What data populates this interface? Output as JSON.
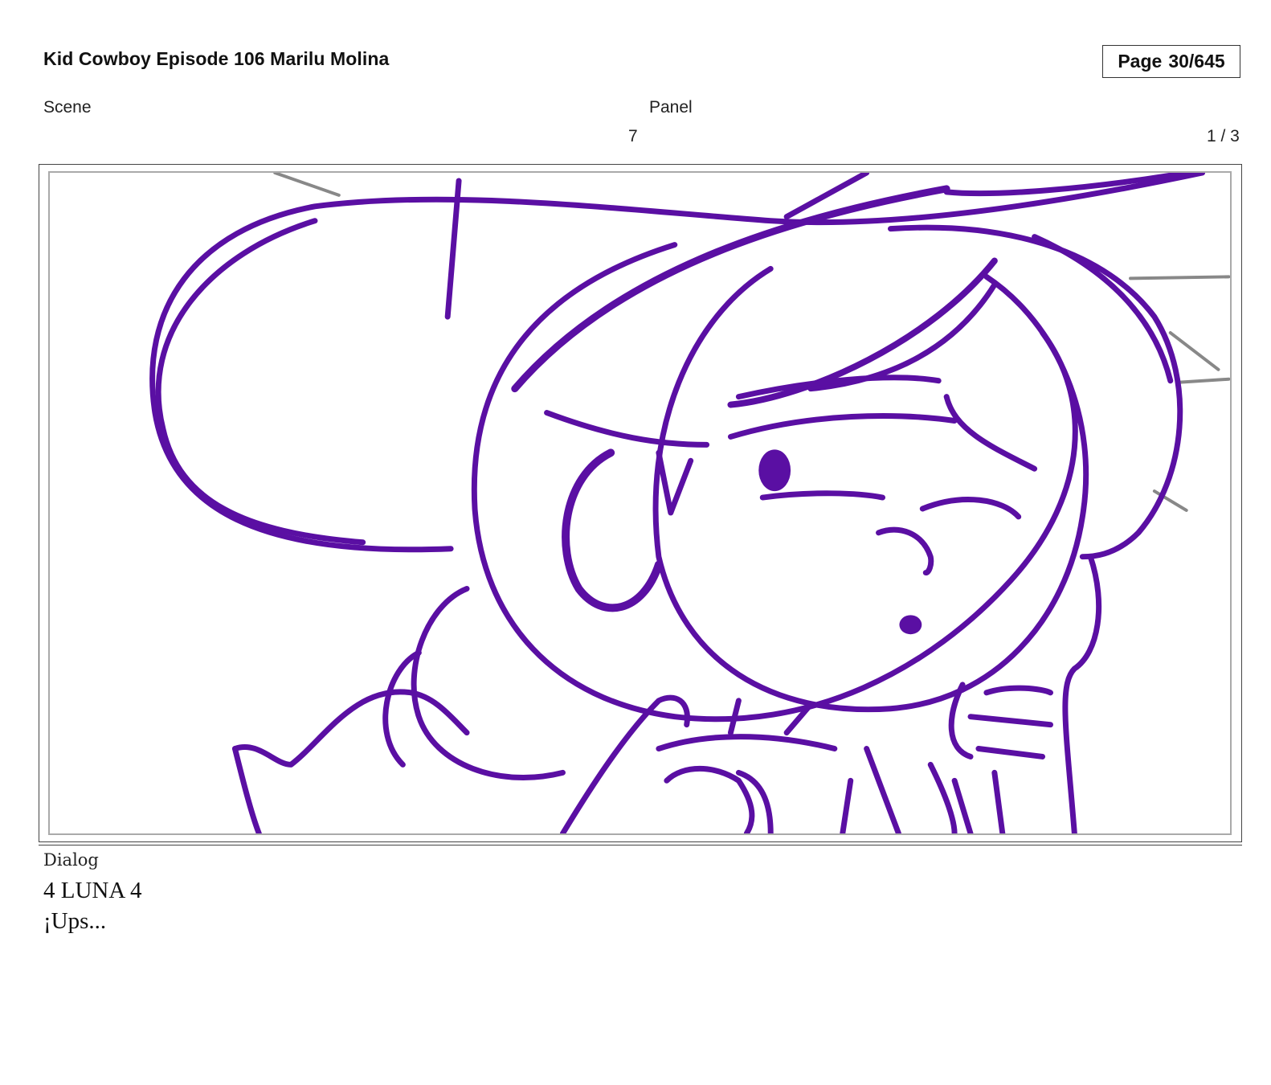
{
  "header": {
    "title": "Kid Cowboy Episode 106 Marilu Molina",
    "page_label": "Page",
    "page_value": "30/645"
  },
  "fields": {
    "scene_label": "Scene",
    "panel_label": "Panel",
    "scene_value": "7",
    "panel_value": "1 / 3"
  },
  "dialog": {
    "label": "Dialog",
    "lines": [
      "4 LUNA 4",
      "¡Ups..."
    ]
  },
  "drawing": {
    "stroke_color": "#5a0fa3",
    "guide_color": "#888888",
    "description_icon": "storyboard-sketch"
  }
}
